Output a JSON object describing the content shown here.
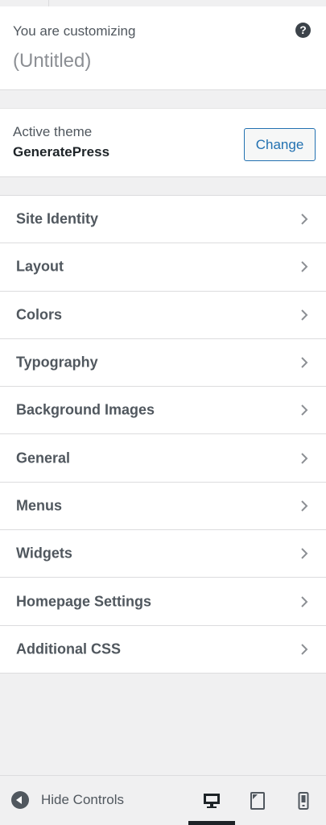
{
  "info": {
    "label": "You are customizing",
    "title": "(Untitled)",
    "help_icon": "help-icon"
  },
  "theme": {
    "label": "Active theme",
    "name": "GeneratePress",
    "change_label": "Change"
  },
  "sections": [
    {
      "label": "Site Identity",
      "icon": "chevron-right-icon"
    },
    {
      "label": "Layout",
      "icon": "chevron-right-icon"
    },
    {
      "label": "Colors",
      "icon": "chevron-right-icon"
    },
    {
      "label": "Typography",
      "icon": "chevron-right-icon"
    },
    {
      "label": "Background Images",
      "icon": "chevron-right-icon"
    },
    {
      "label": "General",
      "icon": "chevron-right-icon"
    },
    {
      "label": "Menus",
      "icon": "chevron-right-icon"
    },
    {
      "label": "Widgets",
      "icon": "chevron-right-icon"
    },
    {
      "label": "Homepage Settings",
      "icon": "chevron-right-icon"
    },
    {
      "label": "Additional CSS",
      "icon": "chevron-right-icon"
    }
  ],
  "footer": {
    "hide_controls_label": "Hide Controls",
    "devices": [
      {
        "name": "desktop",
        "icon": "desktop-icon",
        "active": true
      },
      {
        "name": "tablet",
        "icon": "tablet-icon",
        "active": false
      },
      {
        "name": "mobile",
        "icon": "mobile-icon",
        "active": false
      }
    ]
  },
  "colors": {
    "accent": "#2271b1",
    "text": "#50575e",
    "background": "#f0f0f1",
    "panel": "#ffffff",
    "border": "#dcdcde"
  }
}
